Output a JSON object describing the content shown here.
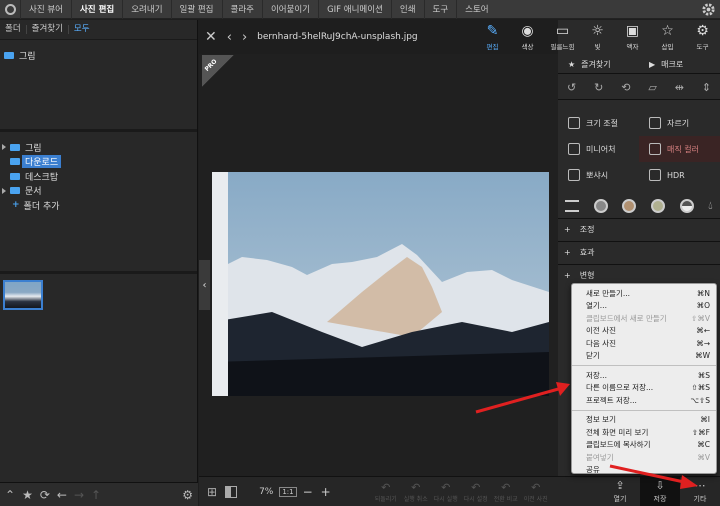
{
  "topbar": {
    "tabs": [
      "사진 뷰어",
      "사진 편집",
      "오려내기",
      "일괄 편집",
      "콜라주",
      "이어붙이기",
      "GIF 애니메이션",
      "인쇄",
      "도구",
      "스토어"
    ],
    "active": "사진 편집"
  },
  "left": {
    "tabs": [
      "폴더",
      "즐겨찾기",
      "모두"
    ],
    "favorites": [
      {
        "label": "그림"
      }
    ],
    "tree": [
      {
        "label": "그림",
        "arrow": true
      },
      {
        "label": "다운로드",
        "selected": true
      },
      {
        "label": "데스크탑"
      },
      {
        "label": "문서",
        "arrow": true
      }
    ],
    "add_folder": "폴더 추가",
    "bottom_icons": [
      "chevron-up-icon",
      "star-icon",
      "sync-icon",
      "back-icon",
      "forward-icon",
      "up-icon",
      "gear-icon"
    ]
  },
  "center": {
    "filename": "bernhard-5helRuJ9chA-unsplash.jpg",
    "pro_badge": "PRO",
    "zoom": "7%",
    "fit_label": "1:1",
    "bottom_actions": [
      "되돌리기",
      "실행 취소",
      "다시 실행",
      "다시 설정",
      "전환 비교",
      "이전 사진"
    ]
  },
  "right": {
    "tools": [
      {
        "label": "편집",
        "active": true
      },
      {
        "label": "색상"
      },
      {
        "label": "필름느낌"
      },
      {
        "label": "빛"
      },
      {
        "label": "액자"
      },
      {
        "label": "삽입"
      },
      {
        "label": "도구"
      }
    ],
    "fav_tabs": [
      "즐겨찾기",
      "매크로"
    ],
    "fx": [
      {
        "label": "크기 조절"
      },
      {
        "label": "자르기"
      },
      {
        "label": "미니어처"
      },
      {
        "label": "매직 컬러",
        "highlight": true
      },
      {
        "label": "뽀샤시"
      },
      {
        "label": "HDR"
      }
    ],
    "sections": [
      "조정",
      "효과",
      "변형"
    ],
    "bottom": [
      {
        "label": "열기"
      },
      {
        "label": "저장",
        "dark": true
      },
      {
        "label": "기타"
      }
    ]
  },
  "menu": {
    "groups": [
      [
        {
          "label": "새로 만들기...",
          "sc": "⌘N"
        },
        {
          "label": "열기...",
          "sc": "⌘O"
        },
        {
          "label": "클립보드에서 새로 만들기",
          "sc": "⇧⌘V",
          "disabled": true
        },
        {
          "label": "이전 사진",
          "sc": "⌘←"
        },
        {
          "label": "다음 사진",
          "sc": "⌘→"
        },
        {
          "label": "닫기",
          "sc": "⌘W"
        }
      ],
      [
        {
          "label": "저장...",
          "sc": "⌘S"
        },
        {
          "label": "다른 이름으로 저장...",
          "sc": "⇧⌘S"
        },
        {
          "label": "프로젝트 저장...",
          "sc": "⌥⇧S"
        }
      ],
      [
        {
          "label": "정보 보기",
          "sc": "⌘I"
        },
        {
          "label": "전체 화면 미리 보기",
          "sc": "⇧⌘F"
        },
        {
          "label": "클립보드에 복사하기",
          "sc": "⌘C"
        },
        {
          "label": "붙여넣기",
          "sc": "⌘V",
          "disabled": true
        },
        {
          "label": "공유",
          "sc": ""
        }
      ]
    ]
  },
  "colors": {
    "accent": "#3b7fd0",
    "annotation": "#e02020"
  }
}
